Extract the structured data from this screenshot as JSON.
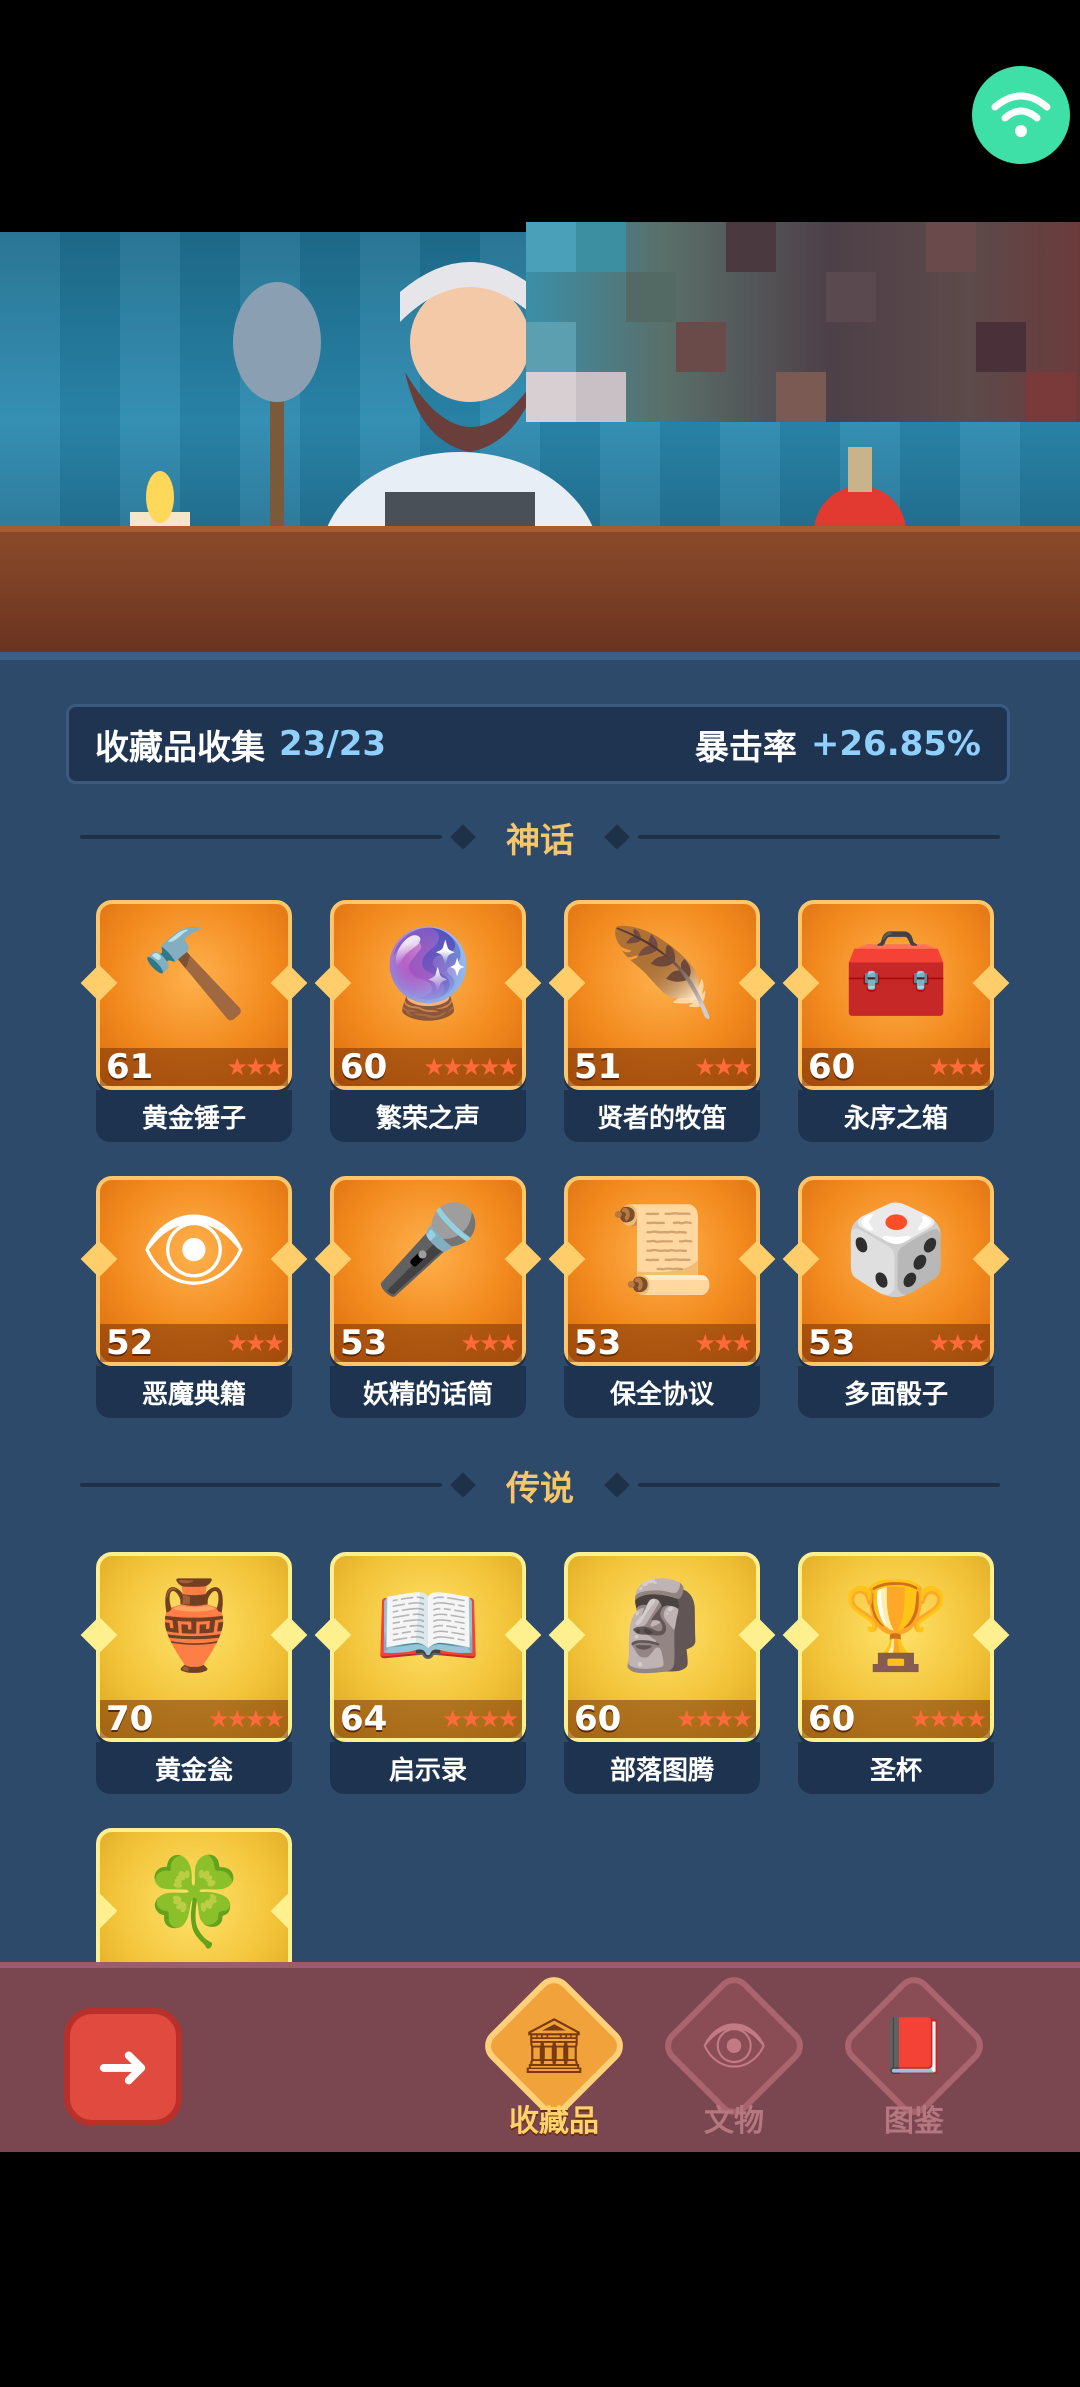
{
  "status": {
    "wifi_icon": "wifi-icon"
  },
  "collection": {
    "title": "收藏品收集",
    "count": "23/23",
    "bonus_label": "暴击率",
    "bonus_value": "+26.85%"
  },
  "sections": {
    "mythic_label": "神话",
    "legend_label": "传说"
  },
  "mythic_items": [
    {
      "name": "黄金锤子",
      "level": "61",
      "icon": "🔨",
      "stars": "★★★"
    },
    {
      "name": "繁荣之声",
      "level": "60",
      "icon": "🔮",
      "stars": "★★★★★"
    },
    {
      "name": "贤者的牧笛",
      "level": "51",
      "icon": "🪶",
      "stars": "★★★"
    },
    {
      "name": "永序之箱",
      "level": "60",
      "icon": "🧰",
      "stars": "★★★"
    },
    {
      "name": "恶魔典籍",
      "level": "52",
      "icon": "👁",
      "stars": "★★★"
    },
    {
      "name": "妖精的话筒",
      "level": "53",
      "icon": "🎤",
      "stars": "★★★"
    },
    {
      "name": "保全协议",
      "level": "53",
      "icon": "📜",
      "stars": "★★★"
    },
    {
      "name": "多面骰子",
      "level": "53",
      "icon": "🎲",
      "stars": "★★★"
    }
  ],
  "legend_items": [
    {
      "name": "黄金瓮",
      "level": "70",
      "icon": "🏺",
      "stars": "★★★★"
    },
    {
      "name": "启示录",
      "level": "64",
      "icon": "📖",
      "stars": "★★★★"
    },
    {
      "name": "部落图腾",
      "level": "60",
      "icon": "🗿",
      "stars": "★★★★"
    },
    {
      "name": "圣杯",
      "level": "60",
      "icon": "🏆",
      "stars": "★★★★"
    },
    {
      "name": "",
      "level": "",
      "icon": "🍀",
      "stars": ""
    }
  ],
  "bottom_nav": {
    "back_icon": "back-arrow-icon",
    "tabs": [
      {
        "label": "收藏品",
        "icon": "🏛"
      },
      {
        "label": "文物",
        "icon": "👁"
      },
      {
        "label": "图鉴",
        "icon": "📕"
      }
    ]
  }
}
